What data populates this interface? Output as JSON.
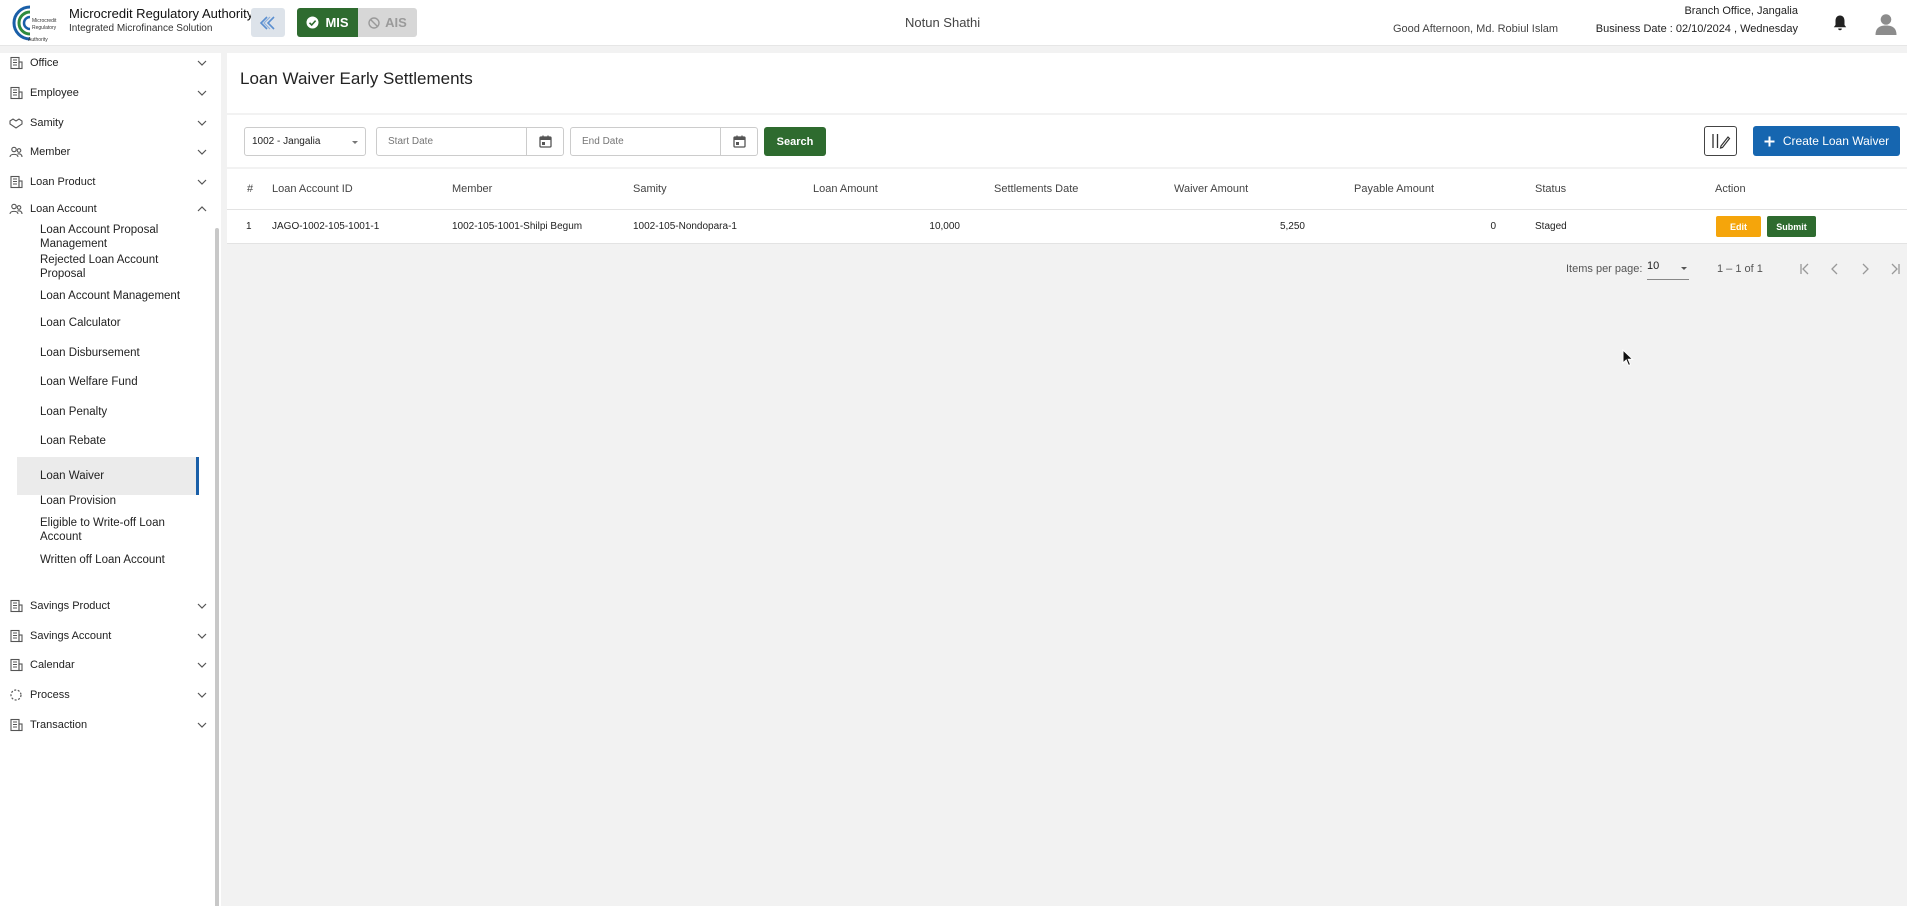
{
  "header": {
    "org_name": "Microcredit Regulatory Authority",
    "org_sub": "Integrated Microfinance Solution",
    "logo_text": [
      "Microcredit",
      "Regulatory",
      "Authority"
    ],
    "mode_mis": "MIS",
    "mode_ais": "AIS",
    "project_name": "Notun Shathi",
    "greeting": "Good Afternoon, Md. Robiul Islam",
    "branch": "Branch Office, Jangalia",
    "business_date": "Business Date : 02/10/2024 , Wednesday",
    "colors": {
      "mis": "#2e6b2f",
      "accent": "#1666b0"
    }
  },
  "sidebar": {
    "menus": [
      {
        "label": "Office",
        "icon": "building-icon"
      },
      {
        "label": "Employee",
        "icon": "building-icon"
      },
      {
        "label": "Samity",
        "icon": "handshake-icon"
      },
      {
        "label": "Member",
        "icon": "users-icon"
      },
      {
        "label": "Loan Product",
        "icon": "building-icon"
      },
      {
        "label": "Loan Account",
        "icon": "users-icon",
        "expanded": true
      },
      {
        "label": "Savings Product",
        "icon": "building-icon"
      },
      {
        "label": "Savings Account",
        "icon": "building-icon"
      },
      {
        "label": "Calendar",
        "icon": "building-icon"
      },
      {
        "label": "Process",
        "icon": "spinner-icon"
      },
      {
        "label": "Transaction",
        "icon": "building-icon"
      }
    ],
    "loan_account_items": [
      "Loan Account Proposal Management",
      "Rejected Loan Account Proposal",
      "Loan Account Management",
      "Loan Calculator",
      "Loan Disbursement",
      "Loan Welfare Fund",
      "Loan Penalty",
      "Loan Rebate",
      "Loan Waiver",
      "Loan Provision",
      "Eligible to Write-off Loan Account",
      "Written off Loan Account"
    ],
    "active_item": "Loan Waiver"
  },
  "page": {
    "title": "Loan Waiver Early Settlements"
  },
  "filters": {
    "branch_value": "1002 - Jangalia",
    "start_placeholder": "Start Date",
    "end_placeholder": "End Date",
    "search_label": "Search",
    "create_label": "Create Loan Waiver"
  },
  "table": {
    "headers": [
      "#",
      "Loan Account ID",
      "Member",
      "Samity",
      "Loan Amount",
      "Settlements Date",
      "Waiver Amount",
      "Payable Amount",
      "Status",
      "Action"
    ],
    "rows": [
      {
        "index": "1",
        "loan_account_id": "JAGO-1002-105-1001-1",
        "member": "1002-105-1001-Shilpi Begum",
        "samity": "1002-105-Nondopara-1",
        "loan_amount": "10,000",
        "settlements_date": "",
        "waiver_amount": "5,250",
        "payable_amount": "0",
        "status": "Staged",
        "edit_label": "Edit",
        "submit_label": "Submit"
      }
    ]
  },
  "paginator": {
    "items_per_page_label": "Items per page:",
    "items_per_page": "10",
    "range": "1 – 1 of 1"
  }
}
